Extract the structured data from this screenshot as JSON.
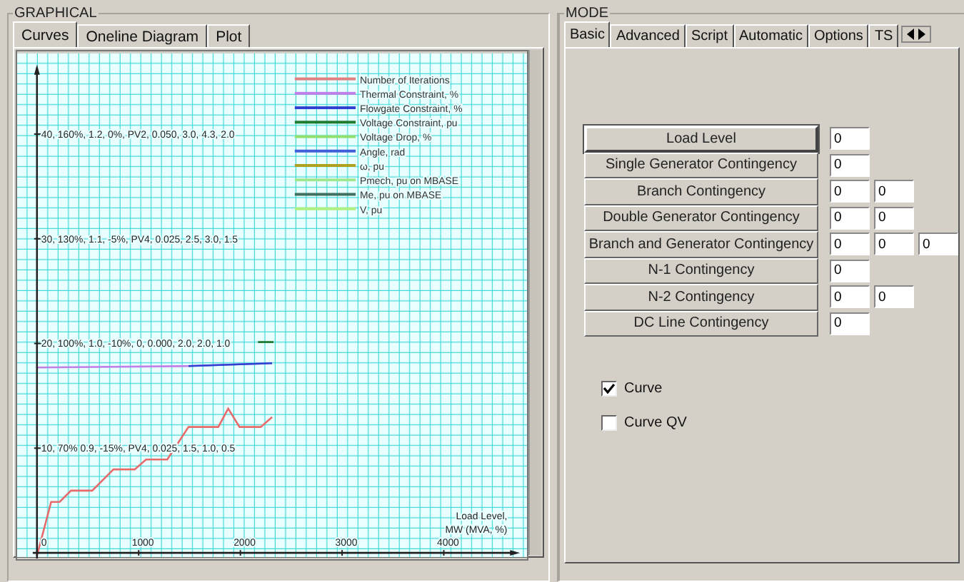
{
  "graphical": {
    "title": "GRAPHICAL",
    "tabs": [
      {
        "label": "Curves",
        "selected": true
      },
      {
        "label": "Oneline Diagram",
        "selected": false
      },
      {
        "label": "Plot",
        "selected": false
      }
    ],
    "plot": {
      "y_labels": [
        "40, 160%, 1.2, 0%, PV2, 0.050, 3.0, 4.3, 2.0",
        "30, 130%, 1.1, -5%, PV4, 0.025, 2.5, 3.0, 1.5",
        "20, 100%, 1.0, -10%, 0, 0.000, 2.0, 2.0, 1.0",
        "10, 70% 0.9, -15%, PV4, 0.025, 1.5, 1.0, 0.5"
      ],
      "x_labels": [
        "0",
        "1000",
        "2000",
        "3000",
        "4000"
      ],
      "axis_title": [
        "Load Level,",
        "MW (MVA, %)"
      ],
      "legend": [
        {
          "name": "Number of Iterations",
          "color": "#e08080"
        },
        {
          "name": "Thermal Constraint, %",
          "color": "#c080e8"
        },
        {
          "name": "Flowgate Constraint, %",
          "color": "#3040d0"
        },
        {
          "name": "Voltage Constraint, pu",
          "color": "#207a30"
        },
        {
          "name": "Voltage Drop, %",
          "color": "#90e070"
        },
        {
          "name": "Angle, rad",
          "color": "#4060d8"
        },
        {
          "name": "ω, pu",
          "color": "#b0a020"
        },
        {
          "name": "Pmech, pu on MBASE",
          "color": "#a0e890"
        },
        {
          "name": "Me, pu on MBASE",
          "color": "#407060"
        },
        {
          "name": "V, pu",
          "color": "#b0f080"
        }
      ]
    }
  },
  "mode": {
    "title": "MODE",
    "tabs": [
      {
        "label": "Basic",
        "selected": true
      },
      {
        "label": "Advanced",
        "selected": false
      },
      {
        "label": "Script",
        "selected": false
      },
      {
        "label": "Automatic",
        "selected": false
      },
      {
        "label": "Options",
        "selected": false
      },
      {
        "label": "TS",
        "selected": false
      }
    ],
    "contingencies": [
      {
        "label": "Load Level",
        "focused": true,
        "fields": [
          "0"
        ]
      },
      {
        "label": "Single Generator Contingency",
        "focused": false,
        "fields": [
          "0"
        ]
      },
      {
        "label": "Branch Contingency",
        "focused": false,
        "fields": [
          "0",
          "0"
        ]
      },
      {
        "label": "Double Generator Contingency",
        "focused": false,
        "fields": [
          "0",
          "0"
        ]
      },
      {
        "label": "Branch and Generator Contingency",
        "focused": false,
        "fields": [
          "0",
          "0",
          "0"
        ]
      },
      {
        "label": "N-1 Contingency",
        "focused": false,
        "fields": [
          "0"
        ]
      },
      {
        "label": "N-2 Contingency",
        "focused": false,
        "fields": [
          "0",
          "0"
        ]
      },
      {
        "label": "DC Line Contingency",
        "focused": false,
        "fields": [
          "0"
        ]
      }
    ],
    "options": [
      {
        "label": "Curve",
        "checked": true
      },
      {
        "label": "Curve QV",
        "checked": false
      }
    ]
  }
}
